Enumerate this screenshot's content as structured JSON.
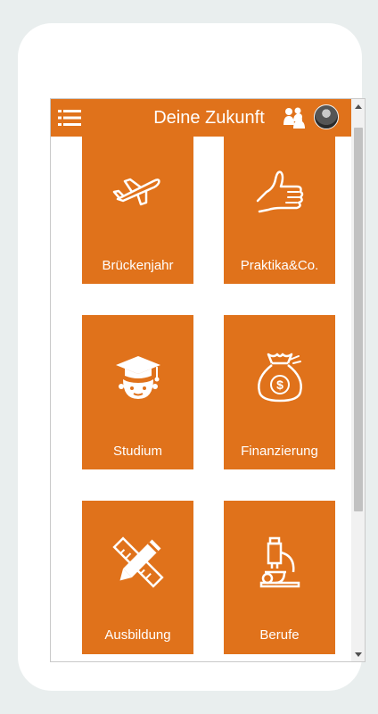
{
  "app": {
    "title": "Deine Zukunft",
    "accent_color": "#e0721b",
    "header_icons": [
      "menu-icon",
      "people-icon",
      "user-avatar"
    ]
  },
  "tiles": [
    {
      "label": "Brückenjahr",
      "icon": "airplane-icon"
    },
    {
      "label": "Praktika&Co.",
      "icon": "thumbs-up-icon"
    },
    {
      "label": "Studium",
      "icon": "graduate-icon"
    },
    {
      "label": "Finanzierung",
      "icon": "money-bag-icon"
    },
    {
      "label": "Ausbildung",
      "icon": "pencil-ruler-icon"
    },
    {
      "label": "Berufe",
      "icon": "microscope-icon"
    }
  ]
}
